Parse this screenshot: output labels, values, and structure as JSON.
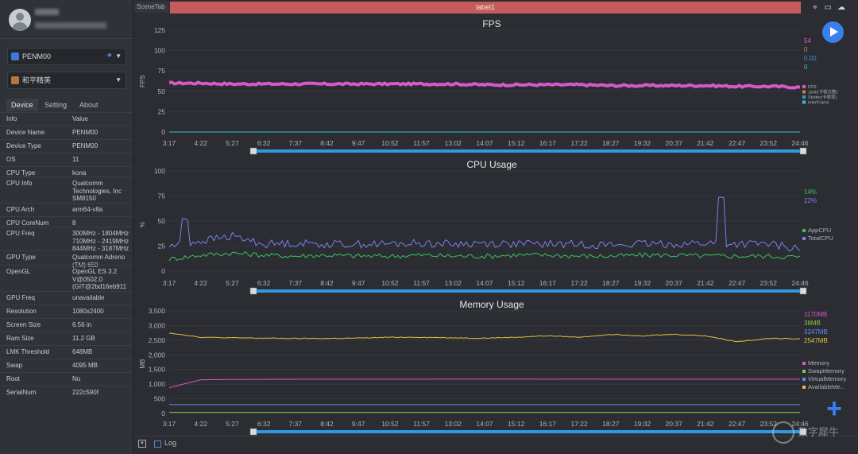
{
  "sidebar": {
    "device_dropdown": "PENM00",
    "app_dropdown": "和平精英",
    "tabs": [
      "Device",
      "Setting",
      "About"
    ],
    "table_header": {
      "key": "Info",
      "value": "Value"
    },
    "rows": [
      {
        "k": "Device Name",
        "v": "PENM00"
      },
      {
        "k": "Device Type",
        "v": "PENM00"
      },
      {
        "k": "OS",
        "v": "11"
      },
      {
        "k": "CPU Type",
        "v": "kona"
      },
      {
        "k": "CPU Info",
        "v": "Qualcomm\nTechnologies, Inc\nSM8150"
      },
      {
        "k": "CPU Arch",
        "v": "arm64-v8a"
      },
      {
        "k": "CPU CoreNum",
        "v": "8"
      },
      {
        "k": "CPU Freq",
        "v": "300MHz - 1804MHz\n710MHz - 2419MHz\n844MHz - 3187MHz"
      },
      {
        "k": "GPU Type",
        "v": "Qualcomm Adreno\n(TM) 650"
      },
      {
        "k": "OpenGL",
        "v": "OpenGL ES 3.2\nV@0502.0\n(GIT@2bd16eb911"
      },
      {
        "k": "GPU Freq",
        "v": "unavailable"
      },
      {
        "k": "Resolution",
        "v": "1080x2400"
      },
      {
        "k": "Screen Size",
        "v": "6.56 in"
      },
      {
        "k": "Ram Size",
        "v": "11.2 GB"
      },
      {
        "k": "LMK Threshold",
        "v": "648MB"
      },
      {
        "k": "Swap",
        "v": "4095 MB"
      },
      {
        "k": "Root",
        "v": "No"
      },
      {
        "k": "SerialNum",
        "v": "222c590f"
      }
    ]
  },
  "toolbar": {
    "scene_tab": "SceneTab",
    "label": "label1",
    "icons": [
      "location-icon",
      "folder-icon",
      "cloud-icon"
    ]
  },
  "bottom": {
    "log_label": "Log",
    "watermark": "数字犀牛"
  },
  "colors": {
    "fps": "#d45ac8",
    "jank": "#e27b2e",
    "stutter": "#3f8fd8",
    "interframe": "#34c3c8",
    "appcpu": "#3cc45c",
    "totalcpu": "#7b7ff0",
    "memory": "#d45ac8",
    "swap": "#8bc34a",
    "virtual": "#5a8fe8",
    "available": "#e0c23a",
    "accent": "#3a7ff0"
  },
  "chart_data": [
    {
      "type": "line",
      "title": "FPS",
      "ylabel": "FPS",
      "ylim": [
        0,
        125
      ],
      "yticks": [
        "0",
        "25",
        "50",
        "75",
        "100",
        "125"
      ],
      "x": [
        "3:17",
        "4:22",
        "5:27",
        "6:32",
        "7:37",
        "8:42",
        "9:47",
        "10:52",
        "11:57",
        "13:02",
        "14:07",
        "15:12",
        "16:17",
        "17:22",
        "18:27",
        "19:32",
        "20:37",
        "21:42",
        "22:47",
        "23:52",
        "24:46"
      ],
      "series": [
        {
          "name": "FPS",
          "current": "54",
          "values": [
            60,
            60,
            59,
            59,
            59,
            59,
            59,
            59,
            59,
            59,
            58,
            58,
            58,
            58,
            57,
            57,
            57,
            57,
            56,
            56,
            55
          ]
        },
        {
          "name": "Jank(卡顿次数)",
          "current": "0",
          "values": [
            0,
            0,
            0,
            0,
            0,
            0,
            0,
            0,
            0,
            0,
            0,
            0,
            0,
            0,
            0,
            0,
            0,
            0,
            0,
            0,
            0
          ]
        },
        {
          "name": "Stutter(卡顿率)",
          "current": "0.00",
          "values": [
            0,
            0,
            0,
            0,
            0,
            0,
            0,
            0,
            0,
            0,
            0,
            0,
            0,
            0,
            0,
            0,
            0,
            0,
            0,
            0,
            0
          ]
        },
        {
          "name": "InterFrame",
          "current": "0",
          "values": [
            0,
            0,
            0,
            0,
            0,
            0,
            0,
            0,
            0,
            0,
            0,
            0,
            0,
            0,
            0,
            0,
            0,
            0,
            0,
            0,
            0
          ]
        }
      ]
    },
    {
      "type": "line",
      "title": "CPU Usage",
      "ylabel": "%",
      "ylim": [
        0,
        100
      ],
      "yticks": [
        "0",
        "25",
        "50",
        "75",
        "100"
      ],
      "x": [
        "3:17",
        "4:22",
        "5:27",
        "6:32",
        "7:37",
        "8:42",
        "9:47",
        "10:52",
        "11:57",
        "13:02",
        "14:07",
        "15:12",
        "16:17",
        "17:22",
        "18:27",
        "19:32",
        "20:37",
        "21:42",
        "22:47",
        "23:52",
        "24:46"
      ],
      "series": [
        {
          "name": "AppCPU",
          "current": "14%",
          "values": [
            12,
            16,
            18,
            16,
            15,
            16,
            15,
            15,
            16,
            15,
            15,
            16,
            16,
            15,
            15,
            16,
            16,
            15,
            15,
            15,
            14
          ]
        },
        {
          "name": "TotalCPU",
          "current": "22%",
          "values": [
            25,
            30,
            35,
            27,
            28,
            27,
            27,
            27,
            28,
            27,
            28,
            27,
            27,
            27,
            26,
            27,
            27,
            28,
            27,
            27,
            22
          ]
        }
      ]
    },
    {
      "type": "line",
      "title": "Memory Usage",
      "ylabel": "MB",
      "ylim": [
        0,
        3500
      ],
      "yticks": [
        "0",
        "500",
        "1,000",
        "1,500",
        "2,000",
        "2,500",
        "3,000",
        "3,500"
      ],
      "x": [
        "3:17",
        "4:22",
        "5:27",
        "6:32",
        "7:37",
        "8:42",
        "9:47",
        "10:52",
        "11:57",
        "13:02",
        "14:07",
        "15:12",
        "16:17",
        "17:22",
        "18:27",
        "19:32",
        "20:37",
        "21:42",
        "22:47",
        "23:52",
        "24:46"
      ],
      "series": [
        {
          "name": "Memory",
          "current": "1170MB",
          "values": [
            880,
            1150,
            1160,
            1165,
            1168,
            1170,
            1170,
            1170,
            1170,
            1172,
            1175,
            1172,
            1170,
            1172,
            1170,
            1170,
            1170,
            1170,
            1170,
            1170,
            1170
          ]
        },
        {
          "name": "SwapMemory",
          "current": "38MB",
          "values": [
            38,
            38,
            38,
            38,
            38,
            38,
            38,
            38,
            38,
            38,
            38,
            38,
            38,
            38,
            38,
            38,
            38,
            38,
            38,
            38,
            38
          ]
        },
        {
          "name": "VirtualMemory",
          "current": "3247MB",
          "values": [
            300,
            300,
            300,
            300,
            300,
            300,
            300,
            300,
            300,
            300,
            300,
            300,
            300,
            300,
            300,
            300,
            300,
            300,
            300,
            300,
            300
          ]
        },
        {
          "name": "AvailableMe...",
          "current": "2547MB",
          "values": [
            2750,
            2600,
            2580,
            2570,
            2560,
            2560,
            2570,
            2600,
            2600,
            2580,
            2570,
            2600,
            2650,
            2600,
            2700,
            2650,
            2700,
            2650,
            2450,
            2560,
            2550
          ]
        }
      ]
    }
  ]
}
